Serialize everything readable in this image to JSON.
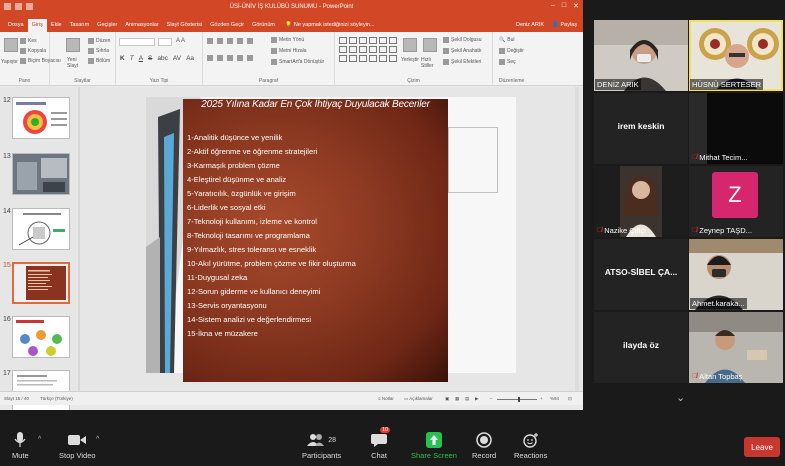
{
  "ppt": {
    "window_title": "ÜSİ-ÜNİV İŞ KULÜBÜ SUNUMU - PowerPoint",
    "tabs": [
      "Dosya",
      "Giriş",
      "Ekle",
      "Tasarım",
      "Geçişler",
      "Animasyonlar",
      "Slayt Gösterisi",
      "Gözden Geçir",
      "Görünüm"
    ],
    "tell_me": "Ne yapmak istediğinizi söyleyin...",
    "user": "Deniz ARIK",
    "share": "Paylaş",
    "ribbon": {
      "clipboard": {
        "paste": "Yapıştır",
        "cut": "Kes",
        "copy": "Kopyala",
        "format_painter": "Biçim Boyacısı",
        "label": "Pano"
      },
      "slides": {
        "new_slide": "Yeni Slayt",
        "layout": "Düzen",
        "reset": "Sıfırla",
        "section": "Bölüm",
        "label": "Slaytlar"
      },
      "font": {
        "label": "Yazı Tipi",
        "bold": "K",
        "italic": "T",
        "underline": "A",
        "strike": "S",
        "shadow": "abc",
        "spacing": "AV",
        "case": "Aa"
      },
      "paragraph": {
        "text_direction": "Metin Yönü",
        "align_text": "Metni Hizala",
        "smartart": "SmartArt'a Dönüştür",
        "label": "Paragraf"
      },
      "drawing": {
        "arrange": "Yerleştir",
        "quick_styles": "Hızlı Stiller",
        "shape_fill": "Şekil Dolgusu",
        "shape_outline": "Şekil Anahattı",
        "shape_effects": "Şekil Efektleri",
        "label": "Çizim"
      },
      "editing": {
        "find": "Bul",
        "replace": "Değiştir",
        "select": "Seç",
        "label": "Düzenleme"
      }
    },
    "thumb_numbers": [
      "12",
      "13",
      "14",
      "15",
      "16",
      "17"
    ],
    "slide": {
      "title": "2025 Yılına Kadar En Çok İhtiyaç Duyulacak Beceriler",
      "skills": [
        "1-Analitik düşünce ve yenilik",
        "2-Aktif öğrenme ve öğrenme stratejileri",
        "3-Karmaşık problem çözme",
        "4-Eleştirel düşünme ve analiz",
        "5-Yaratıcılık, özgünlük ve girişim",
        "6-Liderlik ve sosyal etki",
        "7-Teknoloji kullanımı, izleme ve kontrol",
        "8-Teknoloji tasarımı ve programlama",
        "9-Yılmazlık, stres toleransı ve esneklik",
        "10-Akıl yürütme, problem çözme ve fikir oluşturma",
        "11-Duygusal zeka",
        "12-Sorun giderme ve kullanıcı deneyimi",
        "13-Servis oryantasyonu",
        "14-Sistem analizi ve değerlendirmesi",
        "15-İkna ve müzakere"
      ]
    },
    "status": {
      "slide_counter": "Slayt 15 / 40",
      "language": "Türkçe (Türkiye)",
      "notes": "Notlar",
      "comments": "Açıklamalar",
      "zoom": "%94"
    }
  },
  "participants": [
    {
      "name": "DENİZ ARIK",
      "video": true,
      "muted": false
    },
    {
      "name": "HÜSNÜ SERTESER",
      "video": true,
      "muted": false,
      "active_speaker": true
    },
    {
      "name": "irem keskin",
      "video": false,
      "muted": false
    },
    {
      "name": "Mithat Tecim...",
      "video": true,
      "muted": true
    },
    {
      "name": "Nazike Çiftçi",
      "video": true,
      "muted": true
    },
    {
      "name": "Zeynep TAŞD...",
      "video": false,
      "muted": true,
      "avatar_letter": "Z"
    },
    {
      "name": "ATSO-SİBEL ÇA...",
      "video": false,
      "muted": false
    },
    {
      "name": "Ahmet.karaka...",
      "video": true,
      "muted": false
    },
    {
      "name": "ilayda öz",
      "video": false,
      "muted": false
    },
    {
      "name": "Altan Topbaş",
      "video": true,
      "muted": true
    }
  ],
  "tile_overlay_texts": {
    "logo_text_1": "İŞ KU",
    "logo_text_2": "TSO"
  },
  "toolbar": {
    "mute": "Mute",
    "stop_video": "Stop Video",
    "participants": "Participants",
    "participants_count": "28",
    "chat": "Chat",
    "chat_badge": "10",
    "share_screen": "Share Screen",
    "record": "Record",
    "reactions": "Reactions",
    "leave": "Leave"
  },
  "colors": {
    "ppt_accent": "#d24726",
    "slide_bg": "#8a3420",
    "active_speaker": "#f2e25a",
    "share_green": "#26c24f",
    "leave_red": "#c8372d",
    "avatar_pink": "#d6266d"
  }
}
